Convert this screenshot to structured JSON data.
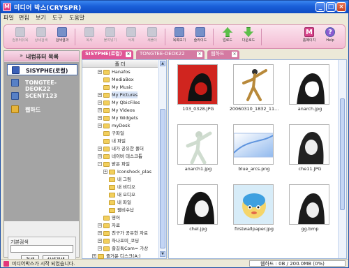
{
  "window": {
    "title": "미디어 박스(CRYSPR)",
    "icon_letter": "M"
  },
  "window_controls": {
    "minimize": "_",
    "maximize": "□",
    "close": "×"
  },
  "menu": [
    "파일",
    "편집",
    "보기",
    "도구",
    "도움말"
  ],
  "toolbar": {
    "groups": [
      [
        {
          "label": "컴퓨터유목",
          "state": "dim",
          "icon": "computer-icon"
        },
        {
          "label": "상세검색",
          "state": "dim",
          "icon": "search-icon"
        },
        {
          "label": "검색결과",
          "state": "on",
          "icon": "results-icon"
        }
      ],
      [
        {
          "label": "복사",
          "state": "dim",
          "icon": "copy-icon"
        },
        {
          "label": "붙여넣기",
          "state": "dim",
          "icon": "paste-icon"
        },
        {
          "label": "삭제",
          "state": "dim",
          "icon": "delete-icon"
        },
        {
          "label": "새폴더",
          "state": "dim",
          "icon": "new-folder-icon"
        }
      ],
      [
        {
          "label": "목록보기",
          "state": "on",
          "icon": "list-view-icon"
        },
        {
          "label": "슬라이드",
          "state": "on",
          "icon": "slideshow-icon"
        }
      ],
      [
        {
          "label": "업로드",
          "state": "up",
          "icon": "upload-icon"
        },
        {
          "label": "다운로드",
          "state": "down",
          "icon": "download-icon"
        }
      ]
    ],
    "home": {
      "label": "홈페이지",
      "glyph": "M",
      "icon": "home-icon"
    },
    "help": {
      "label": "Help",
      "glyph": "?",
      "icon": "help-icon"
    }
  },
  "left_panel": {
    "header": "내컴퓨터 목록",
    "header_glyph": "»",
    "items": [
      {
        "label": "SISYPHE(로컬)",
        "selected": true,
        "icon": "computer-icon"
      },
      {
        "label": "TONGTEE-DEOK22",
        "selected": false,
        "icon": "computer-icon"
      },
      {
        "label": "SCENT123",
        "selected": false,
        "icon": "computer-icon"
      },
      {
        "label": "웹하드",
        "selected": false,
        "icon": "webhard-icon"
      }
    ],
    "search": {
      "caption": "기본검색",
      "input_value": "",
      "search_label": "검색",
      "detail_label": "상세검색"
    }
  },
  "tabs": [
    {
      "label": "SISYPHE(로컬)",
      "active": true
    },
    {
      "label": "TONGTEE-DEOK22",
      "active": false
    },
    {
      "label": "웹하드",
      "active": false
    }
  ],
  "tab_close_glyph": "×",
  "tree": {
    "header": "폴 더",
    "rows": [
      {
        "label": "Hanafos",
        "indent": 1,
        "pm": "+"
      },
      {
        "label": "MediaBox",
        "indent": 1,
        "pm": ""
      },
      {
        "label": "My Music",
        "indent": 1,
        "pm": ""
      },
      {
        "label": "My Pictures",
        "indent": 1,
        "pm": "+",
        "selected": true
      },
      {
        "label": "My QbicFiles",
        "indent": 1,
        "pm": "+"
      },
      {
        "label": "My Videos",
        "indent": 1,
        "pm": "+"
      },
      {
        "label": "My Widgets",
        "indent": 1,
        "pm": "+"
      },
      {
        "label": "myDesk",
        "indent": 1,
        "pm": "+"
      },
      {
        "label": "구파일",
        "indent": 1,
        "pm": ""
      },
      {
        "label": "내 파일",
        "indent": 1,
        "pm": ""
      },
      {
        "label": "내가 공유한 폴더",
        "indent": 1,
        "pm": "+"
      },
      {
        "label": "네이버 데스크톱",
        "indent": 1,
        "pm": "+"
      },
      {
        "label": "받은 파일",
        "indent": 1,
        "pm": "-"
      },
      {
        "label": "Iconshock_plas",
        "indent": 2,
        "pm": "+"
      },
      {
        "label": "내 그림",
        "indent": 2,
        "pm": ""
      },
      {
        "label": "내 비디오",
        "indent": 2,
        "pm": ""
      },
      {
        "label": "내 오디오",
        "indent": 2,
        "pm": ""
      },
      {
        "label": "내 파일",
        "indent": 2,
        "pm": ""
      },
      {
        "label": "웹비수납",
        "indent": 2,
        "pm": ""
      },
      {
        "label": "영어",
        "indent": 1,
        "pm": ""
      },
      {
        "label": "자료",
        "indent": 1,
        "pm": "+"
      },
      {
        "label": "친구가 공유한 자료",
        "indent": 1,
        "pm": "+"
      },
      {
        "label": "하나포미_코딩",
        "indent": 1,
        "pm": "+"
      },
      {
        "label": "즐길톡Com= 가상",
        "indent": 1,
        "pm": "+"
      },
      {
        "label": "즐거운 디스크(A:)",
        "indent": 0,
        "pm": "+"
      }
    ]
  },
  "thumbnails": [
    {
      "caption": "103_0328.JPG",
      "kind": "red-portrait"
    },
    {
      "caption": "20060310_1832_11...",
      "kind": "kick"
    },
    {
      "caption": "anarch.jpg",
      "kind": "bw-portrait"
    },
    {
      "caption": "anarch1.jpg",
      "kind": "faded"
    },
    {
      "caption": "blue_arcs.png",
      "kind": "blue"
    },
    {
      "caption": "che11.JPG",
      "kind": "bw-portrait2"
    },
    {
      "caption": "chel.jpg",
      "kind": "bw-portrait3"
    },
    {
      "caption": "firstwallpaper.jpg",
      "kind": "cartoon"
    },
    {
      "caption": "gg.bmp",
      "kind": "bw-portrait4"
    }
  ],
  "status": {
    "message": "미디어박스가 시작 되었습니다.",
    "quota": "웹하드 : 0B / 200.0MB (0%)",
    "quota_fraction": 0.0
  }
}
